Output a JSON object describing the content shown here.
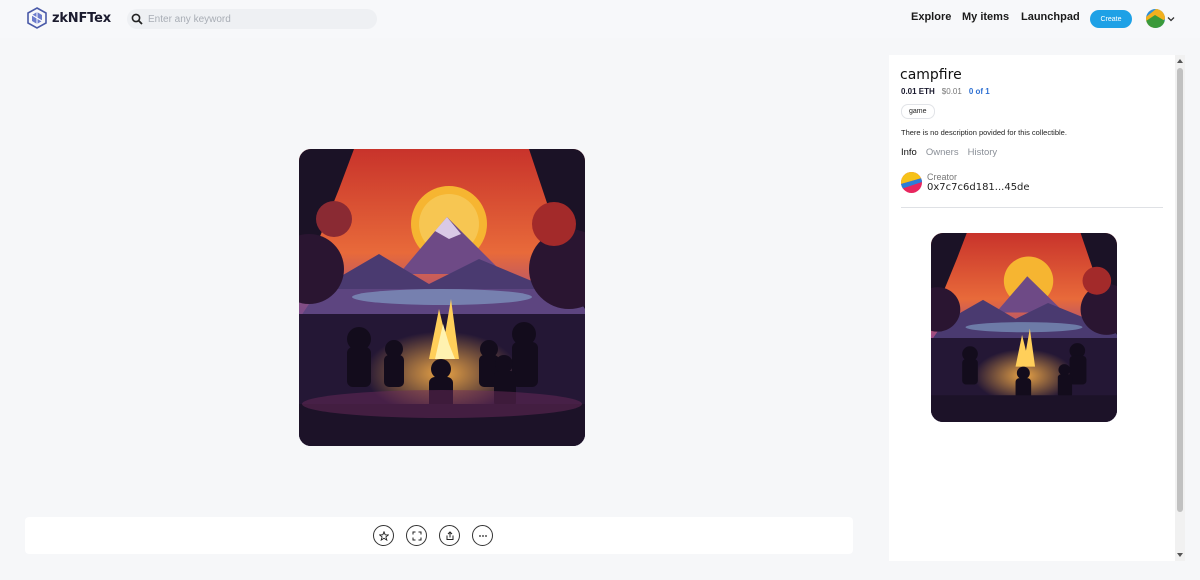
{
  "header": {
    "brand": "zkNFTex",
    "search_placeholder": "Enter any keyword",
    "nav": [
      "Explore",
      "My items",
      "Launchpad"
    ],
    "create_label": "Create"
  },
  "item": {
    "title": "campfire",
    "price_eth": "0.01 ETH",
    "price_usd": "$0.01",
    "supply": "0 of 1",
    "tag": "game",
    "description": "There is no description povided for this collectible.",
    "tabs": [
      "Info",
      "Owners",
      "History"
    ],
    "active_tab": "Info",
    "creator_label": "Creator",
    "creator_address": "0x7c7c6d181...45de"
  },
  "actions": [
    "star-icon",
    "fullscreen-icon",
    "share-icon",
    "more-icon"
  ],
  "colors": {
    "accent": "#1ea1e6",
    "link": "#2d6fd2",
    "sky_top": "#c8332b",
    "sun": "#f6b531",
    "mountain": "#6e4a86",
    "night": "#1b1226"
  }
}
